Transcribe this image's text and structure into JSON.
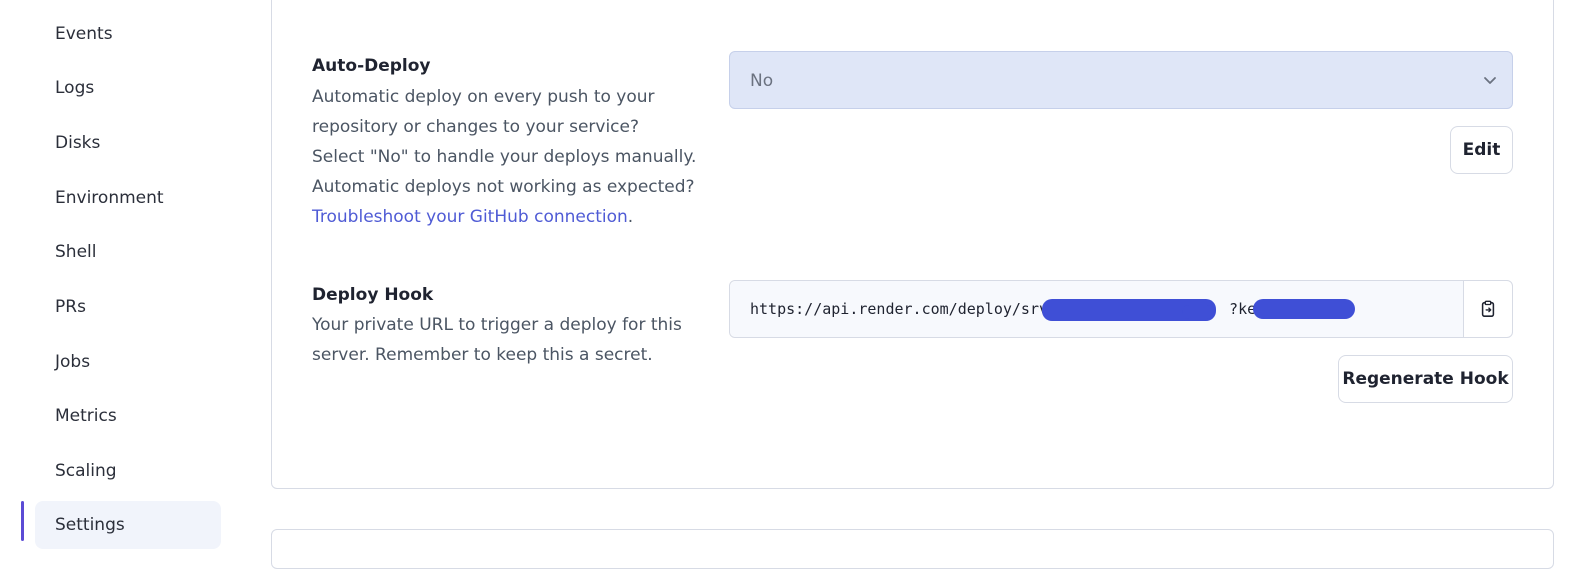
{
  "sidebar": {
    "items": [
      {
        "label": "Events"
      },
      {
        "label": "Logs"
      },
      {
        "label": "Disks"
      },
      {
        "label": "Environment"
      },
      {
        "label": "Shell"
      },
      {
        "label": "PRs"
      },
      {
        "label": "Jobs"
      },
      {
        "label": "Metrics"
      },
      {
        "label": "Scaling"
      },
      {
        "label": "Settings",
        "active": true
      }
    ]
  },
  "auto_deploy": {
    "title": "Auto-Deploy",
    "desc_lines": [
      "Automatic deploy on every push to your",
      "repository or changes to your service?",
      "Select \"No\" to handle your deploys manually.",
      "Automatic deploys not working as expected?"
    ],
    "link_text": "Troubleshoot your GitHub connection",
    "link_suffix": ".",
    "select_value": "No",
    "edit_label": "Edit"
  },
  "deploy_hook": {
    "title": "Deploy Hook",
    "desc_lines": [
      "Your private URL to trigger a deploy for this",
      "server. Remember to keep this a secret."
    ],
    "url_prefix": "https://api.render.com/deploy/srv-",
    "url_key": "?key=",
    "regenerate_label": "Regenerate Hook"
  },
  "colors": {
    "accent": "#5b4bd5",
    "link": "#4f5bd5",
    "redaction": "#3f4fd6",
    "select_bg": "#dfe6f7"
  },
  "icons": {
    "select": "chevron-down-icon",
    "copy": "clipboard-copy-icon"
  }
}
